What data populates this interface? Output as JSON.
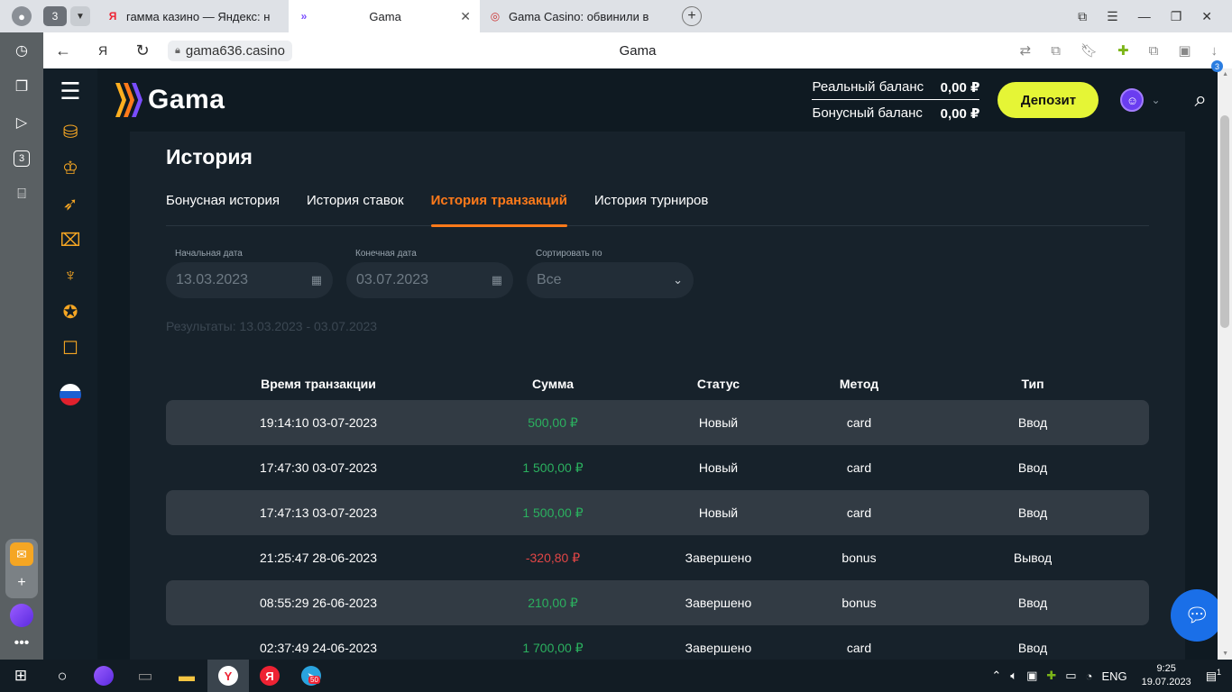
{
  "browser": {
    "tab_count": "3",
    "tabs": [
      {
        "title": "гамма казино — Яндекс: н",
        "icon": "yandex-icon"
      },
      {
        "title": "Gama",
        "icon": "gama-favicon"
      },
      {
        "title": "Gama Casino: обвинили в",
        "icon": "casino-favicon"
      }
    ],
    "url": "gama636.casino",
    "page_title": "Gama",
    "downloads_badge": "3",
    "yandex_sidebar_count": "3"
  },
  "site": {
    "logo": "Gama",
    "real_balance_label": "Реальный баланс",
    "real_balance_value": "0,00 ₽",
    "bonus_balance_label": "Бонусный баланс",
    "bonus_balance_value": "0,00 ₽",
    "deposit_label": "Депозит"
  },
  "history": {
    "title": "История",
    "tabs": [
      "Бонусная история",
      "История ставок",
      "История транзакций",
      "История турниров"
    ],
    "active_tab": "История транзакций",
    "filters": {
      "start_label": "Начальная дата",
      "start_value": "13.03.2023",
      "end_label": "Конечная дата",
      "end_value": "03.07.2023",
      "sort_label": "Сортировать по",
      "sort_value": "Все"
    },
    "results": "Результаты: 13.03.2023 - 03.07.2023",
    "columns": [
      "Время транзакции",
      "Сумма",
      "Статус",
      "Метод",
      "Тип"
    ],
    "rows": [
      {
        "time": "19:14:10 03-07-2023",
        "amount": "500,00 ₽",
        "status": "Новый",
        "method": "card",
        "type": "Ввод"
      },
      {
        "time": "17:47:30 03-07-2023",
        "amount": "1 500,00 ₽",
        "status": "Новый",
        "method": "card",
        "type": "Ввод"
      },
      {
        "time": "17:47:13 03-07-2023",
        "amount": "1 500,00 ₽",
        "status": "Новый",
        "method": "card",
        "type": "Ввод"
      },
      {
        "time": "21:25:47 28-06-2023",
        "amount": "-320,80 ₽",
        "status": "Завершено",
        "method": "bonus",
        "type": "Вывод"
      },
      {
        "time": "08:55:29 26-06-2023",
        "amount": "210,00 ₽",
        "status": "Завершено",
        "method": "bonus",
        "type": "Ввод"
      },
      {
        "time": "02:37:49 24-06-2023",
        "amount": "1 700,00 ₽",
        "status": "Завершено",
        "method": "card",
        "type": "Ввод"
      }
    ]
  },
  "taskbar": {
    "telegram_badge": "50",
    "lang": "ENG",
    "time": "9:25",
    "date": "19.07.2023",
    "notif_count": "1"
  },
  "colors": {
    "accent_orange": "#ff7a1a",
    "deposit_yellow": "#e5f536",
    "positive": "#2bb15f",
    "negative": "#e24646"
  }
}
